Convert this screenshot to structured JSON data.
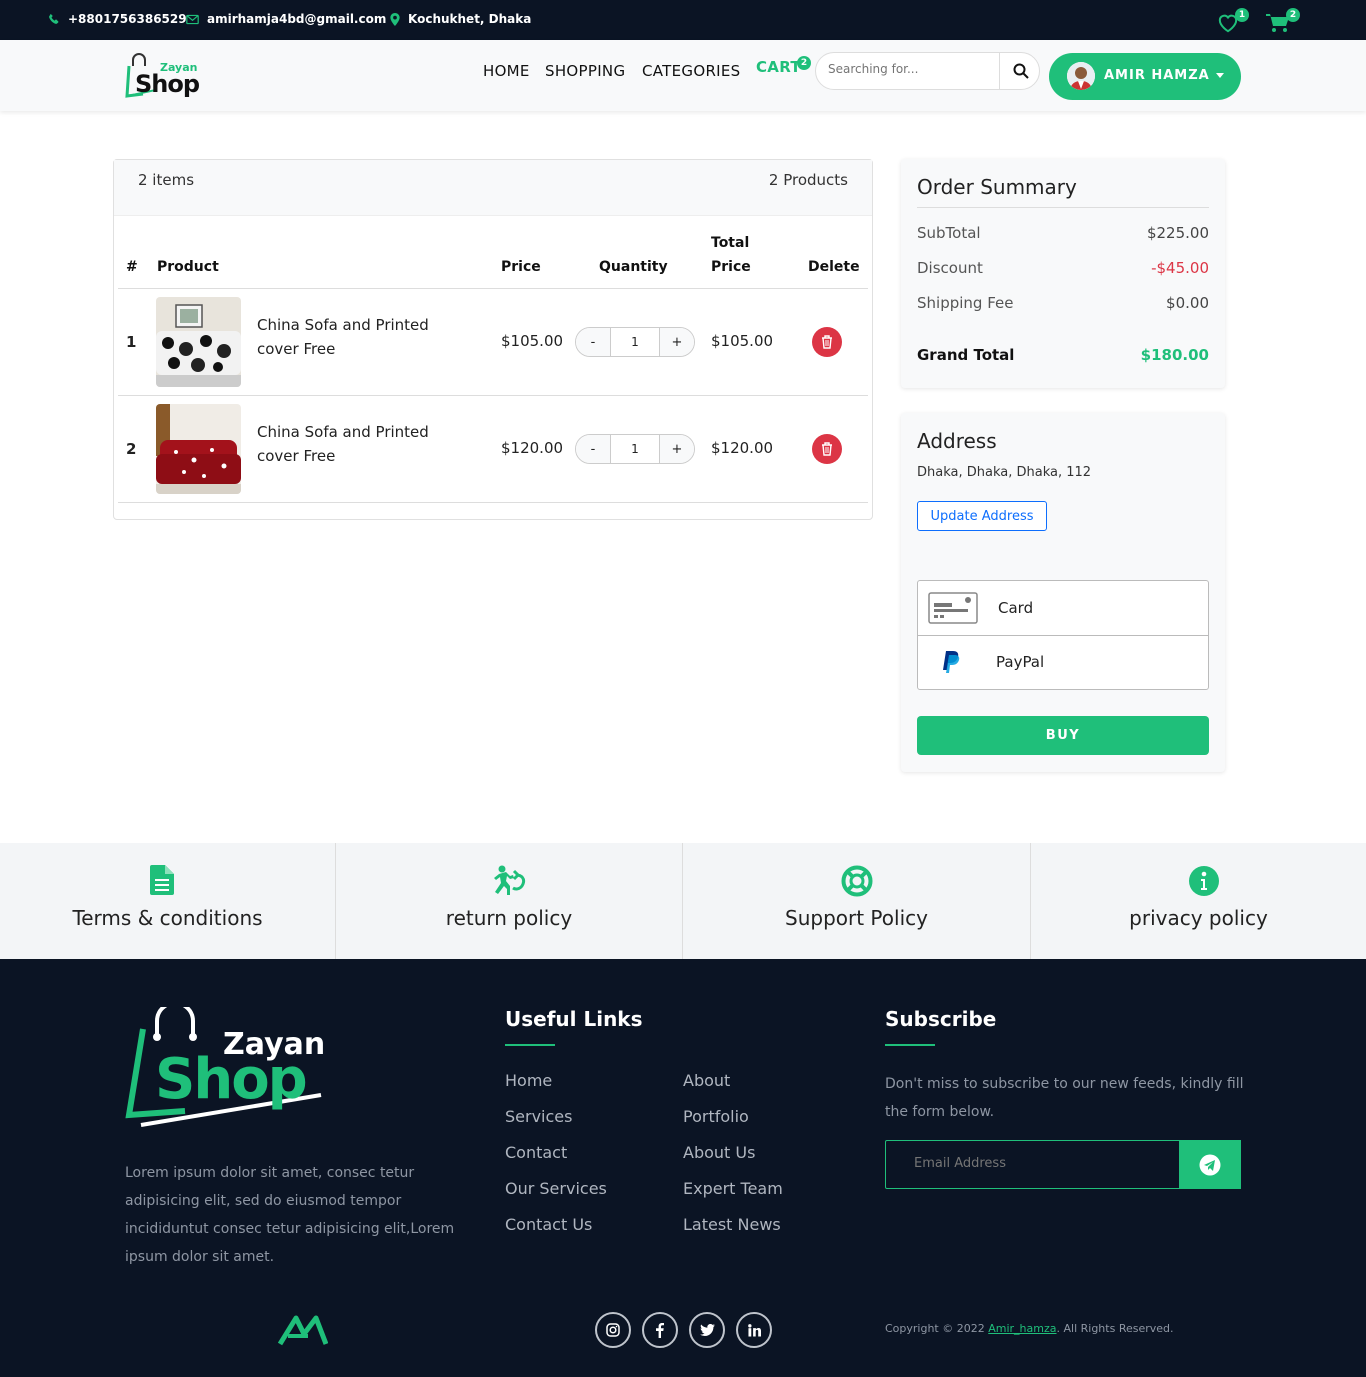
{
  "topbar": {
    "phone": "+8801756386529",
    "email": "amirhamja4bd@gmail.com",
    "location": "Kochukhet, Dhaka",
    "wishlist_count": "1",
    "cart_count": "2"
  },
  "nav": {
    "logo_top": "Zayan",
    "logo_main": "Shop",
    "links": [
      "HOME",
      "SHOPPING",
      "CATEGORIES"
    ],
    "cart_label": "CART",
    "cart_badge": "2",
    "search_placeholder": "Searching for...",
    "user_name": "AMIR HAMZA"
  },
  "cart": {
    "items_label": "2 items",
    "products_label": "2 Products",
    "headers": {
      "num": "#",
      "product": "Product",
      "price": "Price",
      "quantity": "Quantity",
      "total_line1": "Total",
      "total_line2": "Price",
      "delete": "Delete"
    },
    "rows": [
      {
        "num": "1",
        "name_line1": "China Sofa and Printed",
        "name_line2": "cover Free",
        "price": "$105.00",
        "qty": "1",
        "total": "$105.00"
      },
      {
        "num": "2",
        "name_line1": "China Sofa and Printed",
        "name_line2": "cover Free",
        "price": "$120.00",
        "qty": "1",
        "total": "$120.00"
      }
    ],
    "minus": "-",
    "plus": "+"
  },
  "summary": {
    "title": "Order Summary",
    "subtotal_label": "SubTotal",
    "subtotal": "$225.00",
    "discount_label": "Discount",
    "discount": "-$45.00",
    "shipping_label": "Shipping Fee",
    "shipping": "$0.00",
    "grand_label": "Grand Total",
    "grand": "$180.00"
  },
  "address": {
    "title": "Address",
    "value": "Dhaka, Dhaka, Dhaka, 112",
    "update_button": "Update Address",
    "payment_options": [
      "Card",
      "PayPal"
    ],
    "buy_button": "BUY"
  },
  "policies": [
    "Terms & conditions",
    "return policy",
    "Support Policy",
    "privacy policy"
  ],
  "footer": {
    "logo_top": "Zayan",
    "logo_main": "Shop",
    "about": "Lorem ipsum dolor sit amet, consec tetur adipisicing elit, sed do eiusmod tempor incididuntut consec tetur adipisicing elit,Lorem ipsum dolor sit amet.",
    "useful_title": "Useful Links",
    "links_col1": [
      "Home",
      "Services",
      "Contact",
      "Our Services",
      "Contact Us"
    ],
    "links_col2": [
      "About",
      "Portfolio",
      "About Us",
      "Expert Team",
      "Latest News"
    ],
    "subscribe_title": "Subscribe",
    "subscribe_text": "Don't miss to subscribe to our new feeds, kindly fill the form below.",
    "email_placeholder": "Email Address",
    "copyright_prefix": "Copyright © 2022 ",
    "copyright_link": "Amir_hamza",
    "copyright_suffix": ". All Rights Reserved."
  },
  "colors": {
    "accent": "#1fbf7a",
    "dark": "#0b1424",
    "danger": "#dc3545"
  }
}
